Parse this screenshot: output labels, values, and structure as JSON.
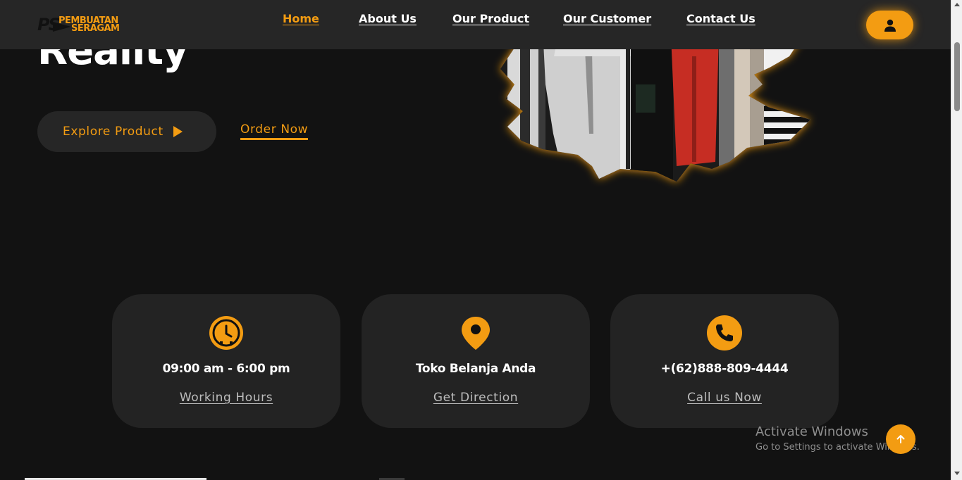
{
  "header": {
    "logo": {
      "mark": "PS",
      "line1": "PEMBUATAN",
      "line2": "SERAGAM"
    },
    "nav": [
      {
        "label": "Home",
        "active": true
      },
      {
        "label": "About Us",
        "active": false
      },
      {
        "label": "Our Product",
        "active": false
      },
      {
        "label": "Our Customer",
        "active": false
      },
      {
        "label": "Contact Us",
        "active": false
      }
    ],
    "profile_icon": "user-icon"
  },
  "hero": {
    "title": "Reality",
    "explore_label": "Explore Product",
    "order_label": "Order Now",
    "image": "clothing-rack-photo"
  },
  "cards": [
    {
      "icon": "clock-icon",
      "title": "09:00 am - 6:00 pm",
      "link": "Working Hours"
    },
    {
      "icon": "location-pin-icon",
      "title": "Toko Belanja Anda",
      "link": "Get Direction"
    },
    {
      "icon": "phone-icon",
      "title": "+(62)888-809-4444",
      "link": "Call us Now"
    }
  ],
  "watermark": {
    "line1": "Activate Windows",
    "line2": "Go to Settings to activate Windows."
  },
  "scroll_top_icon": "arrow-up-icon",
  "colors": {
    "accent": "#f39c12",
    "background": "#121212",
    "header": "#262626",
    "card": "#232323"
  }
}
